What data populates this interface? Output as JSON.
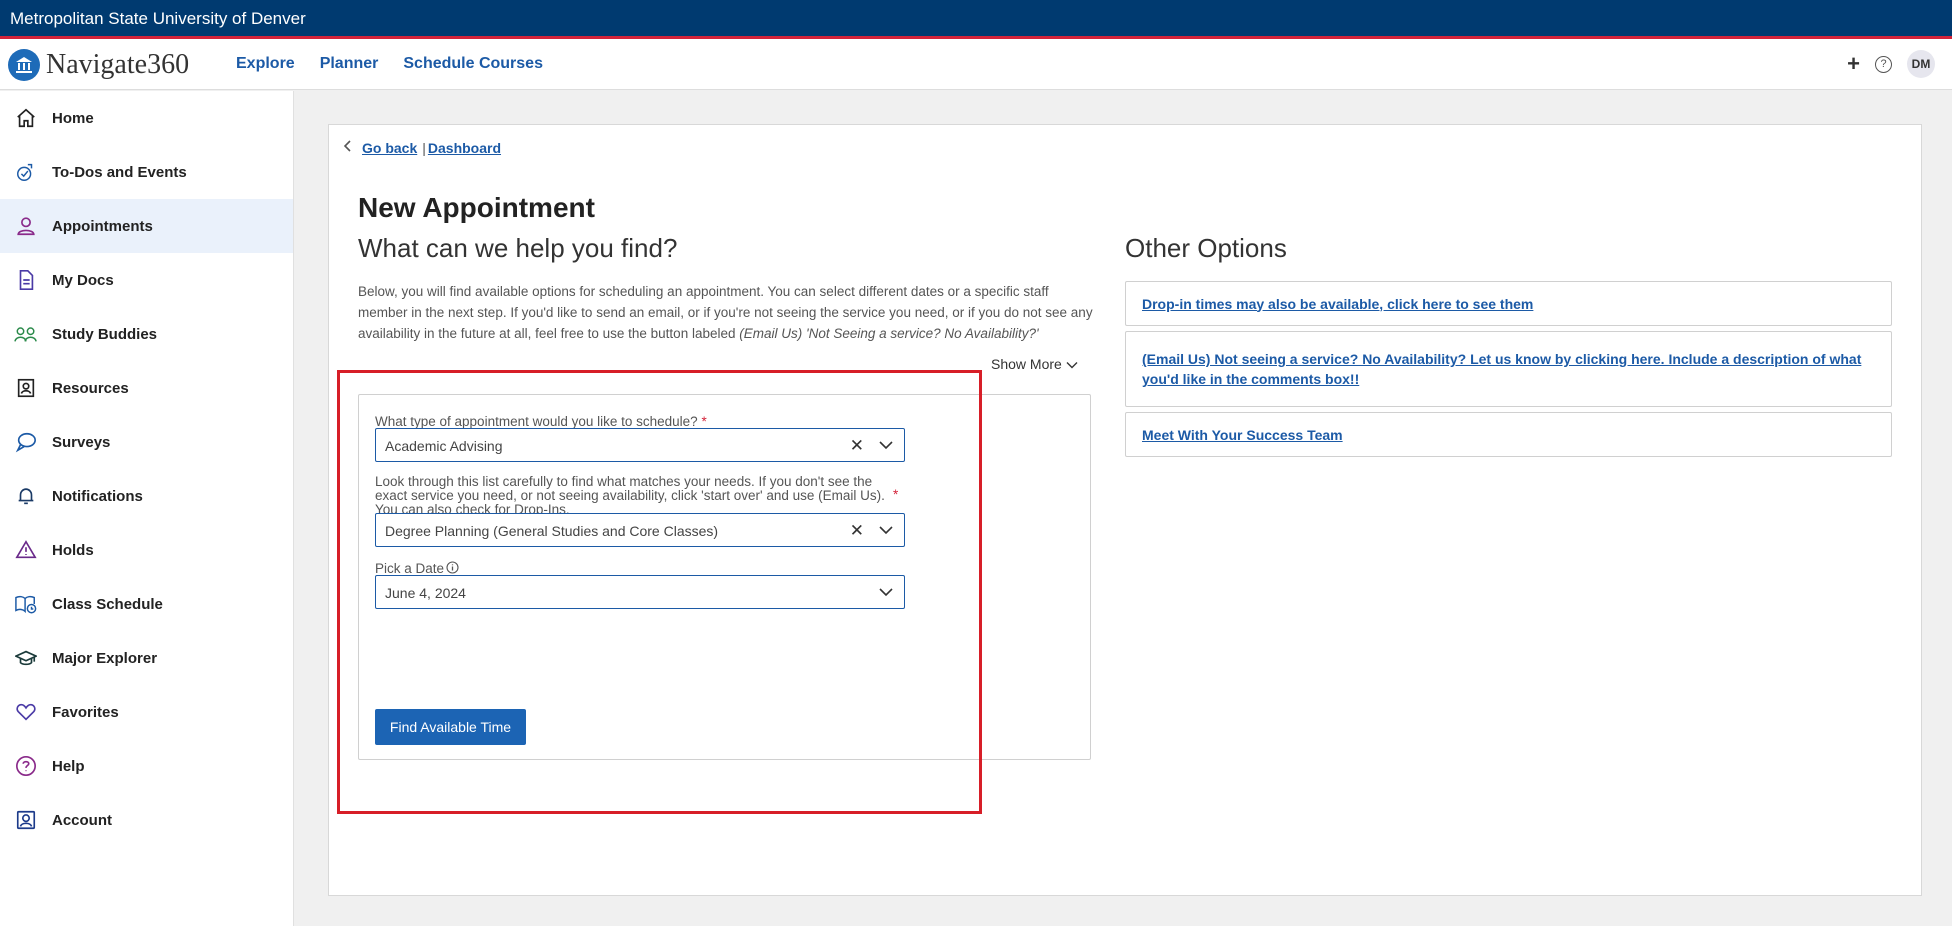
{
  "topbar": {
    "university": "Metropolitan State University of Denver"
  },
  "navbar": {
    "brand": "Navigate360",
    "links": [
      "Explore",
      "Planner",
      "Schedule Courses"
    ],
    "plus": "+",
    "help": "?",
    "avatar_initials": "DM"
  },
  "sidebar": {
    "items": [
      {
        "label": "Home",
        "icon": "home-icon"
      },
      {
        "label": "To-Dos and Events",
        "icon": "todo-icon"
      },
      {
        "label": "Appointments",
        "icon": "person-icon",
        "active": true
      },
      {
        "label": "My Docs",
        "icon": "document-icon"
      },
      {
        "label": "Study Buddies",
        "icon": "people-icon"
      },
      {
        "label": "Resources",
        "icon": "resources-icon"
      },
      {
        "label": "Surveys",
        "icon": "chat-bubble-icon"
      },
      {
        "label": "Notifications",
        "icon": "bell-icon"
      },
      {
        "label": "Holds",
        "icon": "warning-triangle-icon"
      },
      {
        "label": "Class Schedule",
        "icon": "book-icon"
      },
      {
        "label": "Major Explorer",
        "icon": "graduation-cap-icon"
      },
      {
        "label": "Favorites",
        "icon": "heart-icon"
      },
      {
        "label": "Help",
        "icon": "help-icon"
      },
      {
        "label": "Account",
        "icon": "account-icon"
      }
    ]
  },
  "breadcrumb": {
    "back": "Go back",
    "separator": "|",
    "dashboard": "Dashboard"
  },
  "main": {
    "title": "New Appointment",
    "subtitle": "What can we help you find?",
    "intro": "Below, you will find available options for scheduling an appointment. You can select different dates or a specific staff member in the next step. If you'd like to send an email, or if you're not seeing the service you need, or if you do not see any availability in the future at all, feel free to use the button labeled",
    "intro_italic": "(Email Us) 'Not Seeing a service? No Availability?'",
    "show_more": "Show More"
  },
  "form": {
    "type_label": "What type of appointment would you like to schedule?",
    "required_mark": "*",
    "type_value": "Academic Advising",
    "service_label": "Look through this list carefully to find what matches your needs. If you don't see the exact service you need, or not seeing availability, click 'start over' and use (Email Us). You can also check for Drop-Ins.",
    "service_value": "Degree Planning (General Studies and Core Classes)",
    "date_label": "Pick a Date",
    "date_value": "June 4, 2024",
    "find_button": "Find Available Time",
    "clear_glyph": "✕"
  },
  "other_options": {
    "title": "Other Options",
    "items": [
      "Drop-in times may also be available, click here to see them",
      "(Email Us) Not seeing a service? No Availability? Let us know by clicking here. Include a description of what you'd like in the comments box!!",
      "Meet With Your Success Team"
    ]
  },
  "colors": {
    "topbar": "#003a70",
    "accent_red": "#d3233a",
    "link_blue": "#1c5aa6",
    "button_blue": "#1c64b4",
    "highlight_red": "#d71e28"
  }
}
